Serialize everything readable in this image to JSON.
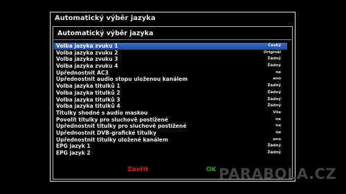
{
  "window": {
    "title": "Automatický výběr jazyka"
  },
  "panel": {
    "title": "Automatický výběr jazyka"
  },
  "items": [
    {
      "label": "Volba jazyka zvuku 1",
      "value": "Český"
    },
    {
      "label": "Volba jazyka zvuku 2",
      "value": "Originál"
    },
    {
      "label": "Volba jazyka zvuku 3",
      "value": "Žádný"
    },
    {
      "label": "Volba jazyka zvuku 4",
      "value": "Žádný"
    },
    {
      "label": "Upřednostnit AC3",
      "value": "ne"
    },
    {
      "label": "Upřednostnit audio stopu uloženou kanálem",
      "value": "ano"
    },
    {
      "label": "Volba jazyka titulků 1",
      "value": "Žádný"
    },
    {
      "label": "Volba jazyka titulků 2",
      "value": "Žádný"
    },
    {
      "label": "Volba jazyka titulků 3",
      "value": "Žádný"
    },
    {
      "label": "Volba jazyka titulků 4",
      "value": "Žádný"
    },
    {
      "label": "Titulky shodné s audio maskou",
      "value": "Vše"
    },
    {
      "label": "Povolit titulky pro sluchově postižené",
      "value": "ne"
    },
    {
      "label": "Upřednostnit titulky pro sluchově postižené",
      "value": "ne"
    },
    {
      "label": "Upřednostnit DVB-grafické titulky",
      "value": "ne"
    },
    {
      "label": "Upřednostnit titulky uložené kanálem",
      "value": "ano"
    },
    {
      "label": "EPG jazyk 1",
      "value": "Žádný"
    },
    {
      "label": "EPG jazyk 2",
      "value": "Žádný"
    }
  ],
  "selected_index": 0,
  "footer": {
    "close_label": "Zavřít",
    "ok_label": "OK"
  },
  "watermark": {
    "text": "PARABOLA.CZ"
  },
  "colors": {
    "selection": "#2a5fb8",
    "close": "#d62020",
    "ok": "#22a022"
  }
}
